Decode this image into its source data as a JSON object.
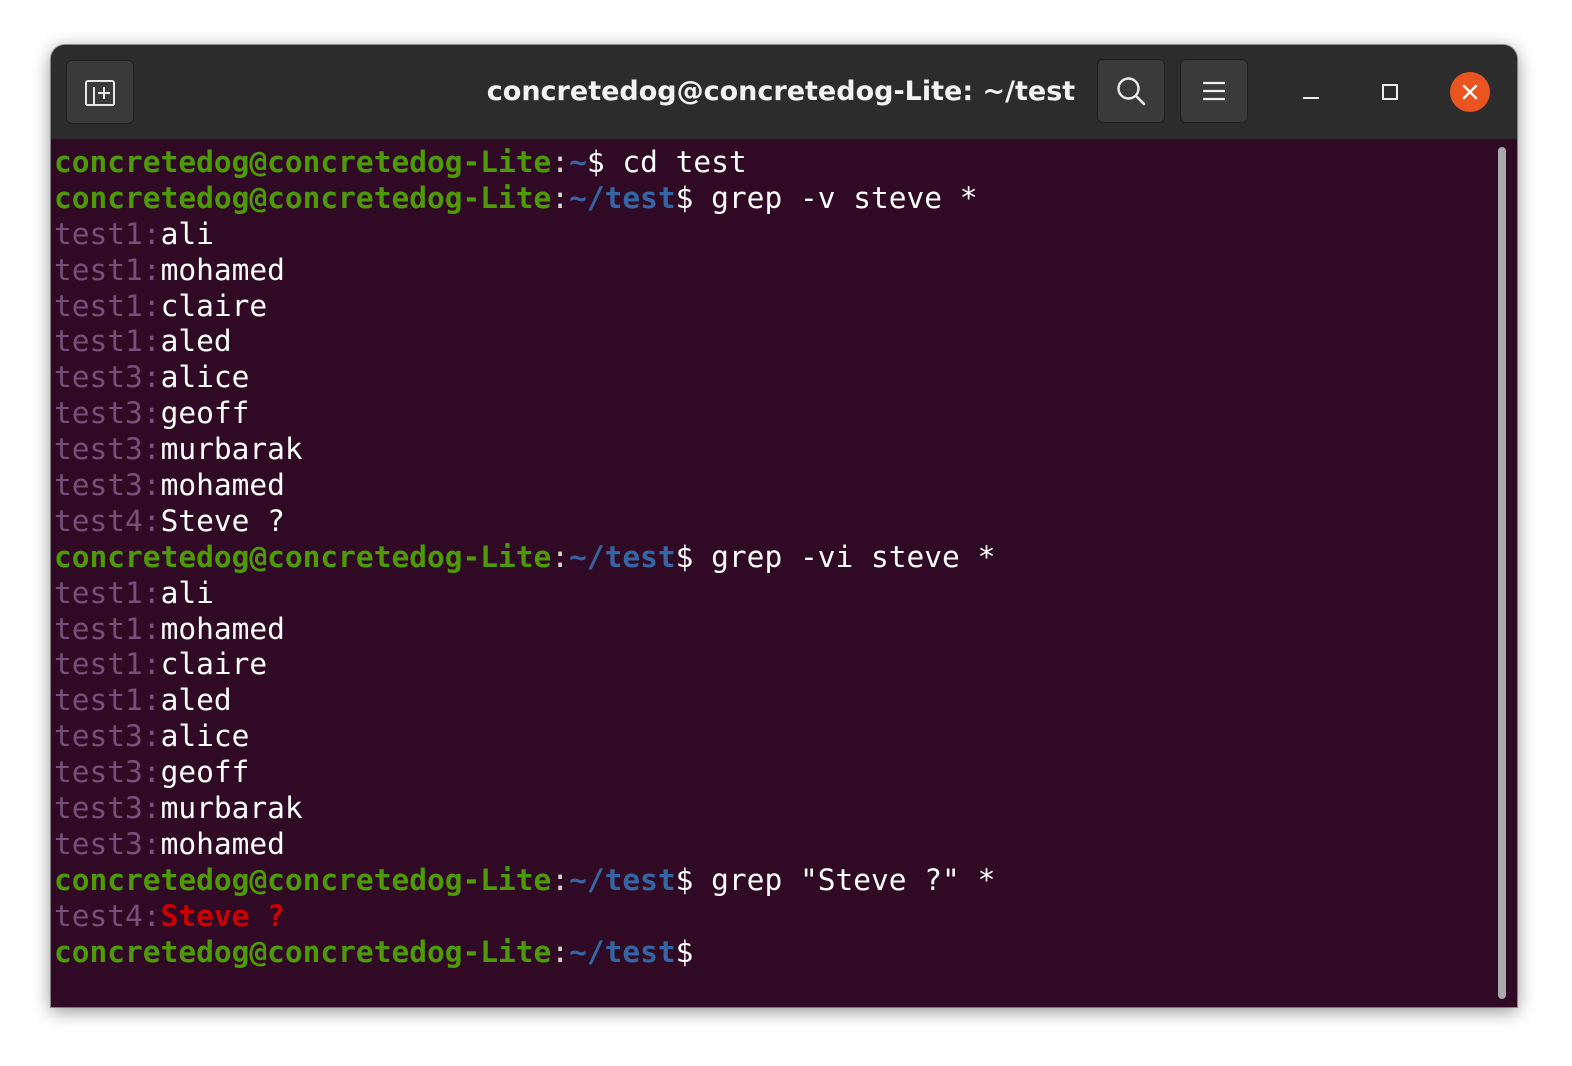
{
  "window": {
    "title": "concretedog@concretedog-Lite: ~/test"
  },
  "titlebar": {
    "new_tab_icon": "new-tab-icon",
    "search_icon": "search-icon",
    "menu_icon": "hamburger-menu-icon",
    "minimize_icon": "minimize-icon",
    "maximize_icon": "maximize-icon",
    "close_icon": "close-icon",
    "close_color": "#e95420"
  },
  "colors": {
    "background": "#300a24",
    "user_host": "#4e9a06",
    "path": "#3465a4",
    "filename": "#75507b",
    "match": "#cc0000",
    "text": "#ffffff"
  },
  "terminal": {
    "lines": [
      [
        {
          "s": "u",
          "t": "concretedog@concretedog-Lite"
        },
        {
          "s": "c",
          "t": ":"
        },
        {
          "s": "p",
          "t": "~"
        },
        {
          "s": "t",
          "t": "$ cd test"
        }
      ],
      [
        {
          "s": "u",
          "t": "concretedog@concretedog-Lite"
        },
        {
          "s": "c",
          "t": ":"
        },
        {
          "s": "p",
          "t": "~/test"
        },
        {
          "s": "t",
          "t": "$ grep -v steve *"
        }
      ],
      [
        {
          "s": "f",
          "t": "test1"
        },
        {
          "s": "f",
          "t": ":"
        },
        {
          "s": "t",
          "t": "ali"
        }
      ],
      [
        {
          "s": "f",
          "t": "test1"
        },
        {
          "s": "f",
          "t": ":"
        },
        {
          "s": "t",
          "t": "mohamed"
        }
      ],
      [
        {
          "s": "f",
          "t": "test1"
        },
        {
          "s": "f",
          "t": ":"
        },
        {
          "s": "t",
          "t": "claire"
        }
      ],
      [
        {
          "s": "f",
          "t": "test1"
        },
        {
          "s": "f",
          "t": ":"
        },
        {
          "s": "t",
          "t": "aled"
        }
      ],
      [
        {
          "s": "f",
          "t": "test3"
        },
        {
          "s": "f",
          "t": ":"
        },
        {
          "s": "t",
          "t": "alice"
        }
      ],
      [
        {
          "s": "f",
          "t": "test3"
        },
        {
          "s": "f",
          "t": ":"
        },
        {
          "s": "t",
          "t": "geoff"
        }
      ],
      [
        {
          "s": "f",
          "t": "test3"
        },
        {
          "s": "f",
          "t": ":"
        },
        {
          "s": "t",
          "t": "murbarak"
        }
      ],
      [
        {
          "s": "f",
          "t": "test3"
        },
        {
          "s": "f",
          "t": ":"
        },
        {
          "s": "t",
          "t": "mohamed"
        }
      ],
      [
        {
          "s": "f",
          "t": "test4"
        },
        {
          "s": "f",
          "t": ":"
        },
        {
          "s": "t",
          "t": "Steve ?"
        }
      ],
      [
        {
          "s": "u",
          "t": "concretedog@concretedog-Lite"
        },
        {
          "s": "c",
          "t": ":"
        },
        {
          "s": "p",
          "t": "~/test"
        },
        {
          "s": "t",
          "t": "$ grep -vi steve *"
        }
      ],
      [
        {
          "s": "f",
          "t": "test1"
        },
        {
          "s": "f",
          "t": ":"
        },
        {
          "s": "t",
          "t": "ali"
        }
      ],
      [
        {
          "s": "f",
          "t": "test1"
        },
        {
          "s": "f",
          "t": ":"
        },
        {
          "s": "t",
          "t": "mohamed"
        }
      ],
      [
        {
          "s": "f",
          "t": "test1"
        },
        {
          "s": "f",
          "t": ":"
        },
        {
          "s": "t",
          "t": "claire"
        }
      ],
      [
        {
          "s": "f",
          "t": "test1"
        },
        {
          "s": "f",
          "t": ":"
        },
        {
          "s": "t",
          "t": "aled"
        }
      ],
      [
        {
          "s": "f",
          "t": "test3"
        },
        {
          "s": "f",
          "t": ":"
        },
        {
          "s": "t",
          "t": "alice"
        }
      ],
      [
        {
          "s": "f",
          "t": "test3"
        },
        {
          "s": "f",
          "t": ":"
        },
        {
          "s": "t",
          "t": "geoff"
        }
      ],
      [
        {
          "s": "f",
          "t": "test3"
        },
        {
          "s": "f",
          "t": ":"
        },
        {
          "s": "t",
          "t": "murbarak"
        }
      ],
      [
        {
          "s": "f",
          "t": "test3"
        },
        {
          "s": "f",
          "t": ":"
        },
        {
          "s": "t",
          "t": "mohamed"
        }
      ],
      [
        {
          "s": "u",
          "t": "concretedog@concretedog-Lite"
        },
        {
          "s": "c",
          "t": ":"
        },
        {
          "s": "p",
          "t": "~/test"
        },
        {
          "s": "t",
          "t": "$ grep \"Steve ?\" *"
        }
      ],
      [
        {
          "s": "f",
          "t": "test4"
        },
        {
          "s": "f",
          "t": ":"
        },
        {
          "s": "r",
          "t": "Steve ?"
        }
      ],
      [
        {
          "s": "u",
          "t": "concretedog@concretedog-Lite"
        },
        {
          "s": "c",
          "t": ":"
        },
        {
          "s": "p",
          "t": "~/test"
        },
        {
          "s": "t",
          "t": "$"
        }
      ]
    ]
  }
}
